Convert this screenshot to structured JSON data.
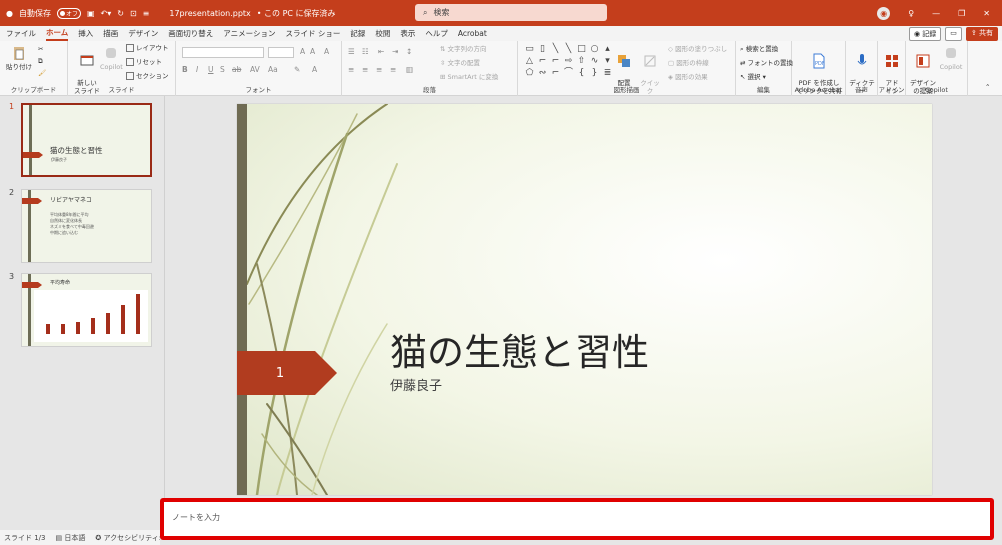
{
  "titlebar": {
    "autosave_label": "自動保存",
    "autosave_state": "オフ",
    "file_name": "17presentation.pptx",
    "save_status": "• この PC に保存済み",
    "search_placeholder": "検索"
  },
  "menu": {
    "tabs": [
      "ファイル",
      "ホーム",
      "挿入",
      "描画",
      "デザイン",
      "画面切り替え",
      "アニメーション",
      "スライド ショー",
      "記録",
      "校閲",
      "表示",
      "ヘルプ",
      "Acrobat"
    ],
    "active_index": 1,
    "record_label": "記録",
    "share_label": "共有"
  },
  "ribbon": {
    "clipboard": {
      "paste": "貼り付け",
      "label": "クリップボード"
    },
    "slides": {
      "new_slide": "新しい\nスライド",
      "copilot": "Copilot",
      "layout": "レイアウト",
      "reset": "リセット",
      "section": "セクション",
      "label": "スライド"
    },
    "font": {
      "label": "フォント"
    },
    "paragraph": {
      "text_direction": "文字列の方向",
      "align_text": "文字の配置",
      "smartart": "SmartArt に変換",
      "label": "段落"
    },
    "drawing": {
      "arrange": "配置",
      "quick_styles": "クイック\nスタイル",
      "shape_fill": "図形の塗りつぶし",
      "shape_outline": "図形の枠線",
      "shape_effects": "図形の効果",
      "label": "図形描画"
    },
    "editing": {
      "find_replace": "検索と置換",
      "replace_font": "フォントの置換",
      "select": "選択",
      "label": "編集"
    },
    "acrobat": {
      "pdf_share": "PDF を作成し\nてリンクを共有",
      "label": "Adobe Acrobat"
    },
    "voice": {
      "dictate": "ディクテー\nション",
      "label": "音声"
    },
    "addins": {
      "addin": "アド\nイン",
      "label": "アドイン"
    },
    "copilot": {
      "design": "デザイン\nの提案",
      "copilot": "Copilot",
      "label": "Copilot"
    }
  },
  "thumbnails": [
    {
      "number": "1",
      "title": "猫の生態と習性",
      "subtitle": "伊藤良子"
    },
    {
      "number": "2",
      "title": "リビアヤマネコ",
      "bullets": [
        "平均体重8年間に平均",
        "自然体に変化体長",
        "ネズミを食べて中毒回避",
        "中期に追い込む"
      ]
    },
    {
      "number": "3",
      "title": "平均寿命",
      "bar_values": [
        1,
        1.1,
        1.3,
        1.7,
        2.2,
        3,
        4.2
      ]
    }
  ],
  "slide": {
    "number": "1",
    "title": "猫の生態と習性",
    "subtitle": "伊藤良子"
  },
  "notes": {
    "placeholder": "ノートを入力"
  },
  "status": {
    "slide_info": "スライド 1/3",
    "language": "日本語",
    "accessibility": "アクセシビリティ: 問題あ"
  },
  "colors": {
    "accent": "#c43e1c",
    "tag": "#b13c1f",
    "notes_border": "#e00000"
  }
}
